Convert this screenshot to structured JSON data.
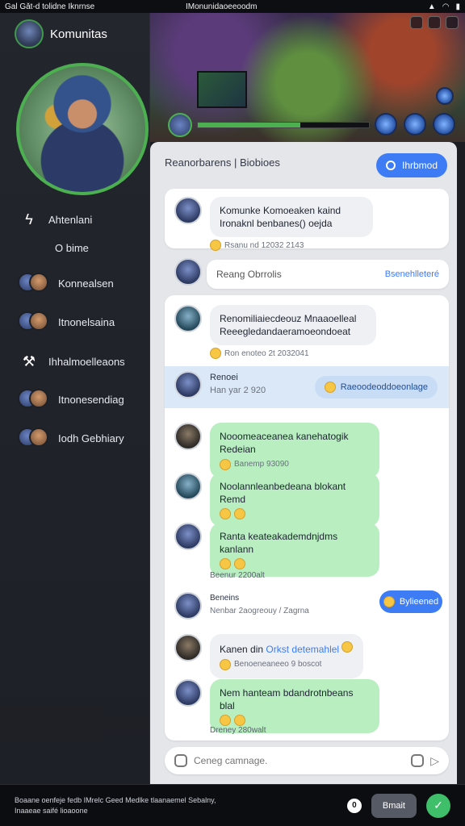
{
  "status_bar": {
    "left_text": "Gal Gǎt-d tolidne Iknrnse",
    "mid_text": "IMonunidaoeeoodm",
    "icons": [
      "signal-icon",
      "wifi-icon",
      "battery-icon"
    ]
  },
  "sidebar": {
    "title": "Komunitas",
    "items": [
      {
        "label": "Ahtenlani",
        "icon": "lightning-icon"
      },
      {
        "label": "O bime",
        "icon": ""
      },
      {
        "label": "Konnealsen",
        "icon": "pair-avatars"
      },
      {
        "label": "Itnonelsaina",
        "icon": "pair-avatars"
      },
      {
        "label": "Ihhalmoelleaons",
        "icon": "hammer-icon"
      },
      {
        "label": "Itnonesendiag",
        "icon": "pair-avatars"
      },
      {
        "label": "Iodh Gebhiary",
        "icon": "pair-avatars"
      }
    ]
  },
  "chat": {
    "header": "Reanorbarens | Biobioes",
    "header_button": "Ihrbmod",
    "search_placeholder": "Reang Obrrolis",
    "search_link": "Bsenehlleteré",
    "messages": [
      {
        "id": "m1",
        "text_line1": "Komunke Komoeaken kaind",
        "text_line2": "Ironaknl benbanes() oejda",
        "meta": "Rsanu nd 12032 2143"
      },
      {
        "id": "m2",
        "text_line1": "Renomiliaiecdeouz Mnaaoelleal",
        "text_line2": "Reeegledandaeramoeondoeat",
        "meta": "Ron enoteo 2t 2032041"
      },
      {
        "id": "m3",
        "title": "Renoei",
        "meta": "Han yar 2 920",
        "button": "Raeoodeoddoeonlage"
      },
      {
        "id": "m4",
        "text": "Nooomeaceanea kanehatogik Redeian",
        "meta": "Banemp 93090"
      },
      {
        "id": "m5",
        "text": "Noolannleanbedeana blokant Remd",
        "meta": ""
      },
      {
        "id": "m6",
        "text": "Ranta keateakademdnjdms kanlann",
        "meta": ""
      },
      {
        "id": "m7",
        "text": "Beenur 2200alt"
      },
      {
        "id": "m8",
        "title": "Beneins",
        "meta": "Nenbar 2aogreouy / Zagrna",
        "reply": "Bylieened"
      },
      {
        "id": "m9",
        "text_prefix": "Kanen din",
        "text_link": "Orkst detemahlel",
        "meta": "Benoeneaneeo 9 boscot"
      },
      {
        "id": "m10",
        "text": "Nem hanteam bdandrotnbeans blal",
        "meta": ""
      },
      {
        "id": "m11",
        "text": "Dreney 280walt"
      }
    ],
    "input_placeholder": "Ceneg camnage."
  },
  "bottom_bar": {
    "text_line1": "Boaane oenfeje fedb IMrelc Geed Medlke tlaanaemel Sebalny,",
    "text_line2": "Inaaeae saifé lioaoone",
    "button_label": "Bmait"
  }
}
